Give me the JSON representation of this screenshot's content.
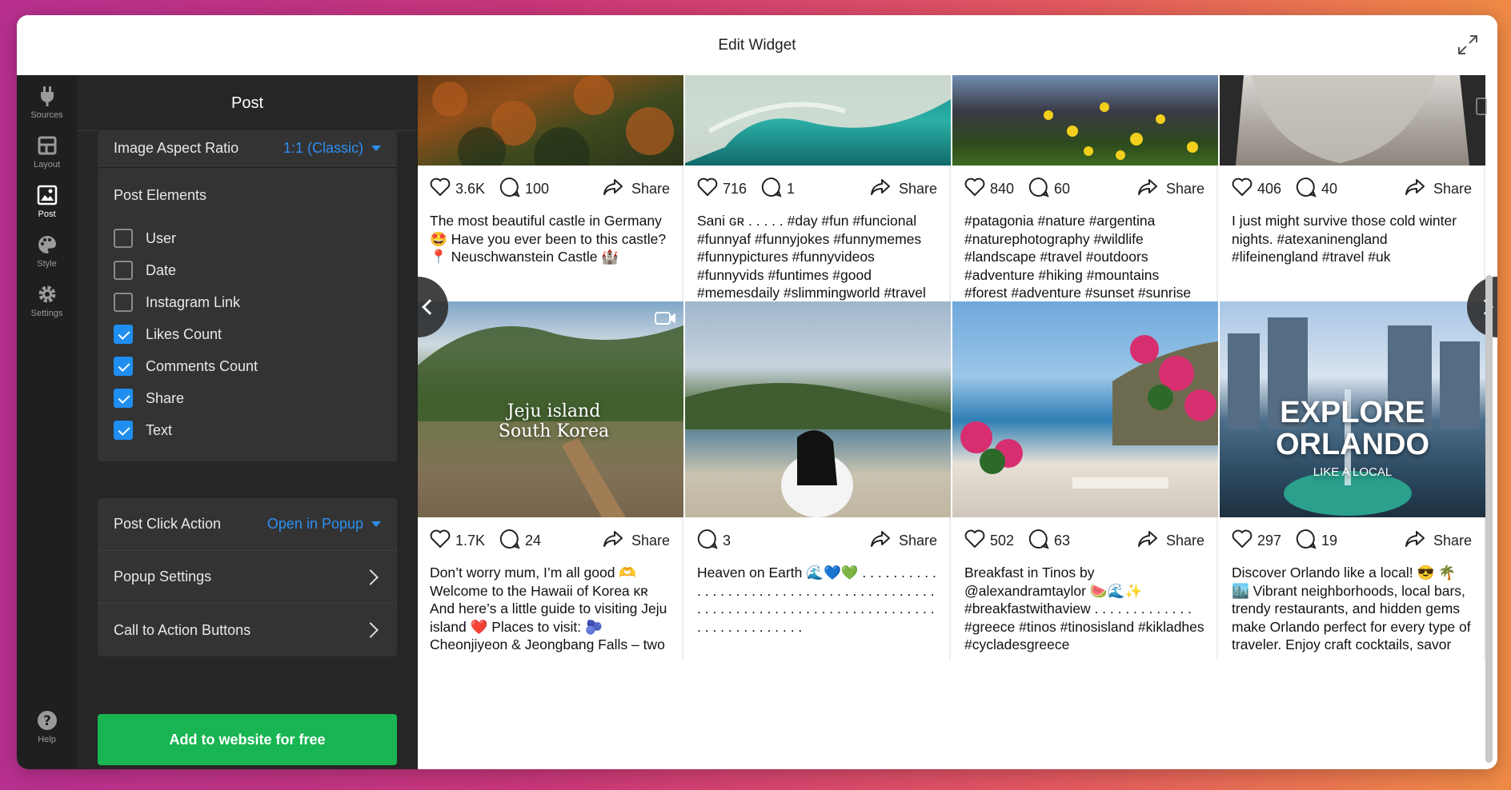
{
  "window": {
    "title": "Edit Widget"
  },
  "rail": {
    "items": [
      {
        "label": "Sources",
        "icon": "plug-icon"
      },
      {
        "label": "Layout",
        "icon": "layout-icon"
      },
      {
        "label": "Post",
        "icon": "image-icon"
      },
      {
        "label": "Style",
        "icon": "palette-icon"
      },
      {
        "label": "Settings",
        "icon": "gear-icon"
      }
    ],
    "help_label": "Help"
  },
  "panel": {
    "title": "Post",
    "image_aspect_ratio": {
      "label": "Image Aspect Ratio",
      "value": "1:1 (Classic)"
    },
    "post_elements": {
      "label": "Post Elements",
      "items": [
        {
          "label": "User",
          "checked": false
        },
        {
          "label": "Date",
          "checked": false
        },
        {
          "label": "Instagram Link",
          "checked": false
        },
        {
          "label": "Likes Count",
          "checked": true
        },
        {
          "label": "Comments Count",
          "checked": true
        },
        {
          "label": "Share",
          "checked": true
        },
        {
          "label": "Text",
          "checked": true
        }
      ]
    },
    "post_click_action": {
      "label": "Post Click Action",
      "value": "Open in Popup"
    },
    "popup_settings": "Popup Settings",
    "cta_buttons": "Call to Action Buttons",
    "add_button": "Add to website for free"
  },
  "colors": {
    "accent_blue": "#2e8ff0",
    "cta_green": "#18b552",
    "checkbox_blue": "#1f8ef1"
  },
  "feed": {
    "share_label": "Share",
    "row1": [
      {
        "likes": "3.6K",
        "comments": "100",
        "caption": "The most beautiful castle in Germany 🤩 Have you ever been to this castle? 📍 Neuschwanstein Castle 🏰"
      },
      {
        "likes": "716",
        "comments": "1",
        "caption": "Sani ɢʀ . . . . . #day #fun #funcional #funnyaf #funnyjokes #funnymemes #funnypictures #funnyvideos #funnyvids #funtimes #good #memesdaily #slimmingworld #travel"
      },
      {
        "likes": "840",
        "comments": "60",
        "caption": "#patagonia #nature #argentina #naturephotography #wildlife #landscape #travel #outdoors #adventure #hiking #mountains #forest #adventure #sunset #sunrise"
      },
      {
        "likes": "406",
        "comments": "40",
        "caption": "I just might survive those cold winter nights. #atexaninengland #lifeinengland #travel #uk"
      }
    ],
    "row2": [
      {
        "likes": "1.7K",
        "comments": "24",
        "overlay1": "Jeju island",
        "overlay2": "South Korea",
        "caption": "Don’t worry mum, I’m all good 🫶 Welcome to the Hawaii of Korea ᴋʀ And here’s a little guide to visiting Jeju island ❤️ Places to visit: 🫐 Cheonjiyeon & Jeongbang Falls – two"
      },
      {
        "likes": "",
        "comments": "3",
        "caption": "Heaven on Earth 🌊💙💚 . . . . . . . . . . . . . . . . . . . . . . . . . . . . . . . . . . . . . . . . . . . . . . . . . . . . . . . . . . . . . . . . . . . . . . . . . . . . . . . . . . . . . ."
      },
      {
        "likes": "502",
        "comments": "63",
        "caption": "Breakfast in Tinos by @alexandramtaylor 🍉🌊✨ #breakfastwithaview . . . . . . . . . . . . . #greece #tinos #tinosisland #kikladhes #cycladesgreece"
      },
      {
        "likes": "297",
        "comments": "19",
        "overlay1": "EXPLORE",
        "overlay2": "ORLANDO",
        "overlay3": "LIKE A LOCAL",
        "caption": "Discover Orlando like a local! 😎 🌴 🏙️ Vibrant neighborhoods, local bars, trendy restaurants, and hidden gems make Orlando perfect for every type of traveler. Enjoy craft cocktails, savor"
      }
    ]
  }
}
